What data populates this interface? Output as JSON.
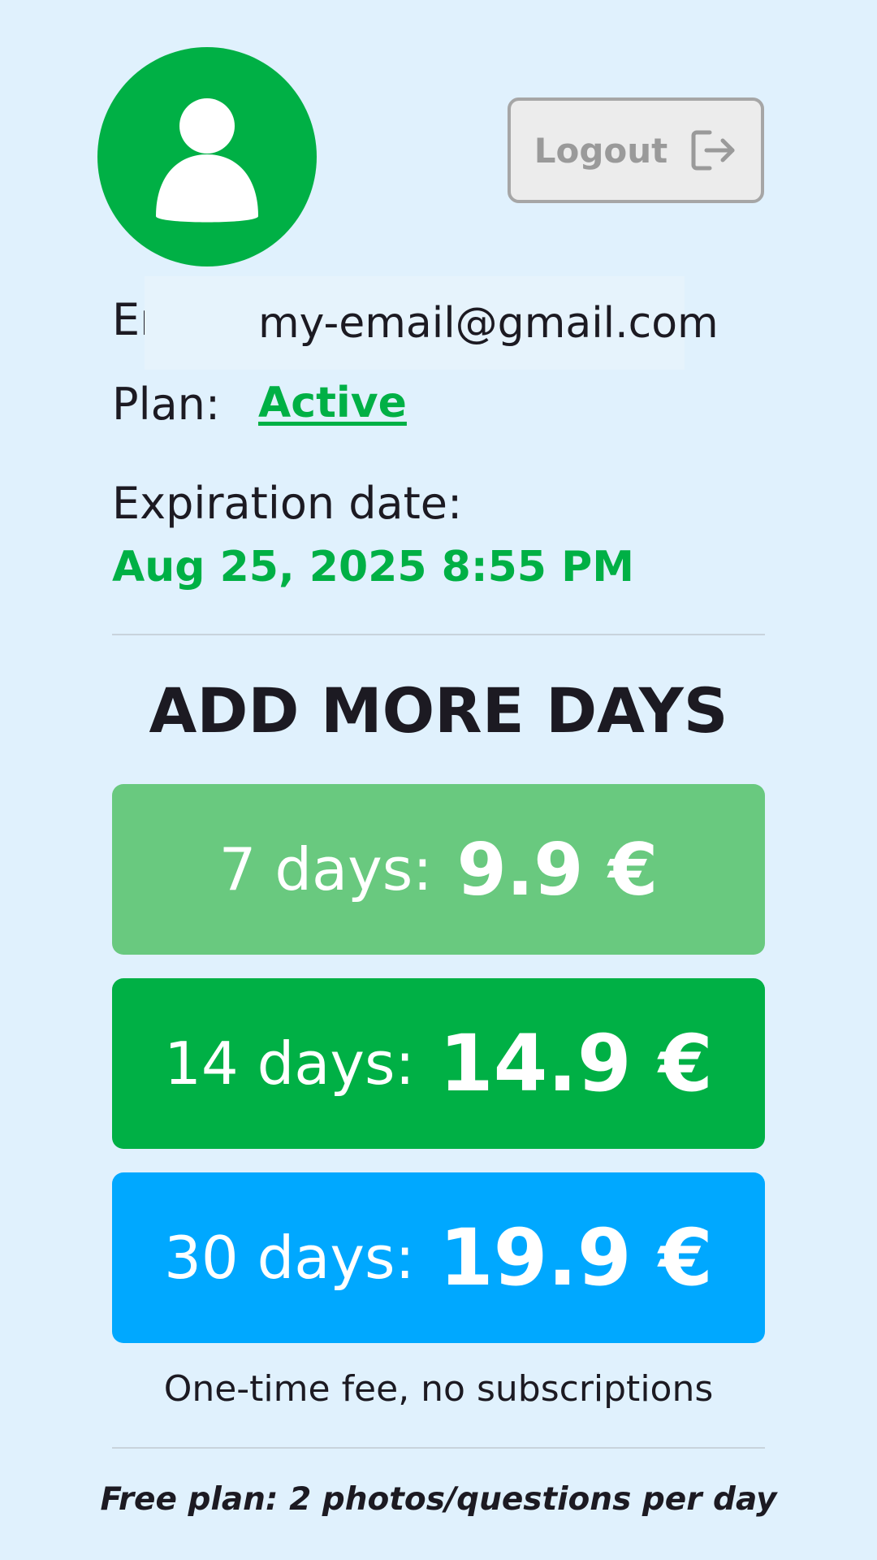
{
  "header": {
    "avatar_icon": "user-icon",
    "logout_label": "Logout",
    "logout_icon": "logout-icon"
  },
  "account": {
    "email_label": "Email:",
    "email_value": "my-email@gmail.com",
    "plan_label": "Plan:",
    "plan_value": "Active",
    "expiration_label": "Expiration date:",
    "expiration_value": "Aug 25, 2025 8:55 PM"
  },
  "offers": {
    "title": "ADD MORE DAYS",
    "items": [
      {
        "days_label": "7 days:",
        "price": "9.9 €",
        "color": "#69c97f"
      },
      {
        "days_label": "14 days:",
        "price": "14.9 €",
        "color": "#00b045"
      },
      {
        "days_label": "30 days:",
        "price": "19.9 €",
        "color": "#00a8ff"
      }
    ],
    "fee_note": "One-time fee, no subscriptions"
  },
  "footer": {
    "free_plan_note": "Free plan: 2 photos/questions per day"
  },
  "colors": {
    "background": "#e0f1fd",
    "accent_green": "#00b045",
    "accent_blue": "#00a8ff",
    "light_green": "#69c97f"
  }
}
